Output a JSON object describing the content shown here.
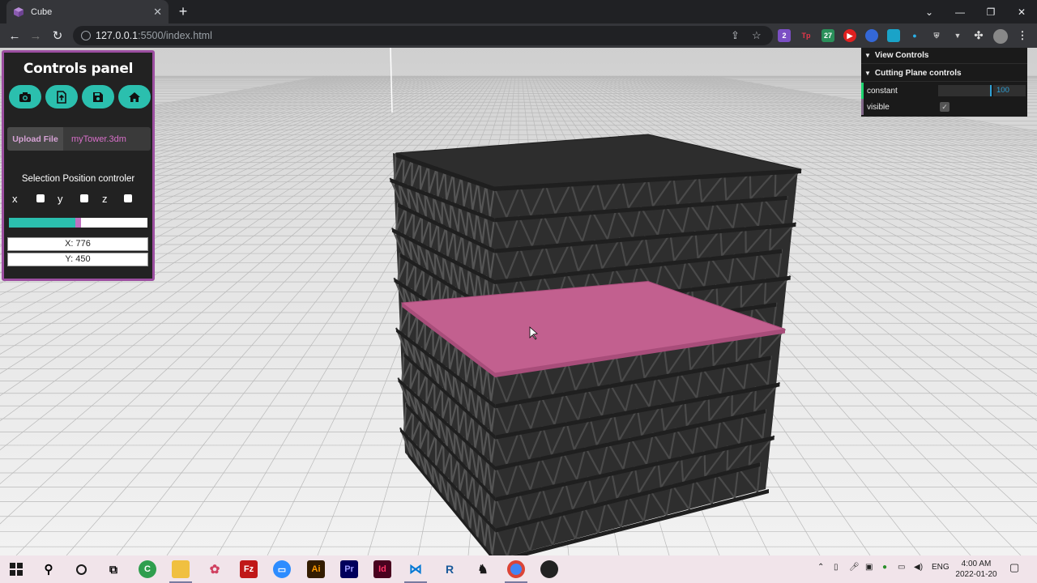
{
  "browser": {
    "tab_title": "Cube",
    "url_host": "127.0.0.1",
    "url_rest": ":5500/index.html",
    "extension_badges": [
      "2",
      "Tp",
      "27",
      "4"
    ]
  },
  "controls_panel": {
    "title": "Controls panel",
    "icon_buttons": [
      "camera-icon",
      "file-export-icon",
      "save-icon",
      "home-icon"
    ],
    "upload_label": "Upload File",
    "file_name": "myTower.3dm",
    "selection_heading": "Selection Position controler",
    "axes": [
      "x",
      "y",
      "z"
    ],
    "slider_value": 0.5,
    "coord_x": "X: 776",
    "coord_y": "Y: 450"
  },
  "gui": {
    "view_folder": "View Controls",
    "cutting_folder": "Cutting Plane controls",
    "constant_label": "constant",
    "constant_value": "100",
    "visible_label": "visible",
    "visible_checked": true
  },
  "taskbar": {
    "language": "ENG",
    "time": "4:00 AM",
    "date": "2022-01-20"
  },
  "colors": {
    "accent_teal": "#2bbfae",
    "panel_border": "#9c4ea0",
    "selected_floor": "#c2608f",
    "floor": "#2d2d2d"
  }
}
